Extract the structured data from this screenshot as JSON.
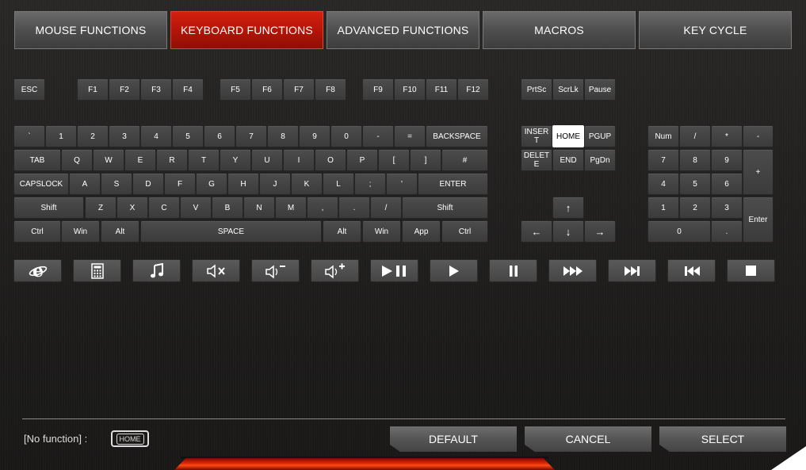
{
  "tabs": [
    {
      "label": "MOUSE FUNCTIONS",
      "active": false
    },
    {
      "label": "KEYBOARD FUNCTIONS",
      "active": true
    },
    {
      "label": "ADVANCED FUNCTIONS",
      "active": false
    },
    {
      "label": "MACROS",
      "active": false
    },
    {
      "label": "KEY CYCLE",
      "active": false
    }
  ],
  "keys": {
    "esc": "ESC",
    "f1": "F1",
    "f2": "F2",
    "f3": "F3",
    "f4": "F4",
    "f5": "F5",
    "f6": "F6",
    "f7": "F7",
    "f8": "F8",
    "f9": "F9",
    "f10": "F10",
    "f11": "F11",
    "f12": "F12",
    "prtsc": "PrtSc",
    "scrlk": "ScrLk",
    "pause": "Pause",
    "backtick": "`",
    "n1": "1",
    "n2": "2",
    "n3": "3",
    "n4": "4",
    "n5": "5",
    "n6": "6",
    "n7": "7",
    "n8": "8",
    "n9": "9",
    "n0": "0",
    "minus": "-",
    "equals": "=",
    "backspace": "BACKSPACE",
    "tab": "TAB",
    "q": "Q",
    "w": "W",
    "e": "E",
    "r": "R",
    "t": "T",
    "y": "Y",
    "u": "U",
    "i": "I",
    "o": "O",
    "p": "P",
    "lbracket": "[",
    "rbracket": "]",
    "hash": "#",
    "capslock": "CAPSLOCK",
    "a": "A",
    "s": "S",
    "d": "D",
    "f": "F",
    "g": "G",
    "h": "H",
    "j": "J",
    "k": "K",
    "l": "L",
    "semicolon": ";",
    "quote": "'",
    "enter": "ENTER",
    "lshift": "Shift",
    "z": "Z",
    "x": "X",
    "c": "C",
    "v": "V",
    "b": "B",
    "n": "N",
    "m": "M",
    "comma": ",",
    "period": ".",
    "slash": "/",
    "rshift": "Shift",
    "lctrl": "Ctrl",
    "lwin": "Win",
    "lalt": "Alt",
    "space": "SPACE",
    "ralt": "Alt",
    "rwin": "Win",
    "app": "App",
    "rctrl": "Ctrl",
    "insert": "INSER\nT",
    "home": "HOME",
    "pgup": "PGUP",
    "delete": "DELET\nE",
    "end": "END",
    "pgdn": "PgDn",
    "up": "↑",
    "left": "←",
    "down": "↓",
    "right": "→",
    "num": "Num",
    "np_slash": "/",
    "np_star": "*",
    "np_minus": "-",
    "np7": "7",
    "np8": "8",
    "np9": "9",
    "np_plus": "+",
    "np4": "4",
    "np5": "5",
    "np6": "6",
    "np1": "1",
    "np2": "2",
    "np3": "3",
    "np_enter": "Enter",
    "np0": "0",
    "np_dot": "."
  },
  "media_keys": [
    "browser-icon",
    "calculator-icon",
    "music-icon",
    "mute-icon",
    "volume-down-icon",
    "volume-up-icon",
    "play-pause-icon",
    "play-icon",
    "pause-icon",
    "fast-forward-icon",
    "next-track-icon",
    "previous-track-icon",
    "stop-icon"
  ],
  "status": {
    "label": "[No function] :",
    "current_key": "HOME"
  },
  "buttons": {
    "default": "DEFAULT",
    "cancel": "CANCEL",
    "select": "SELECT"
  },
  "colors": {
    "active_tab": "#c0180a",
    "selected_key": "#ffffff",
    "accent_glow": "#ff4a14"
  }
}
